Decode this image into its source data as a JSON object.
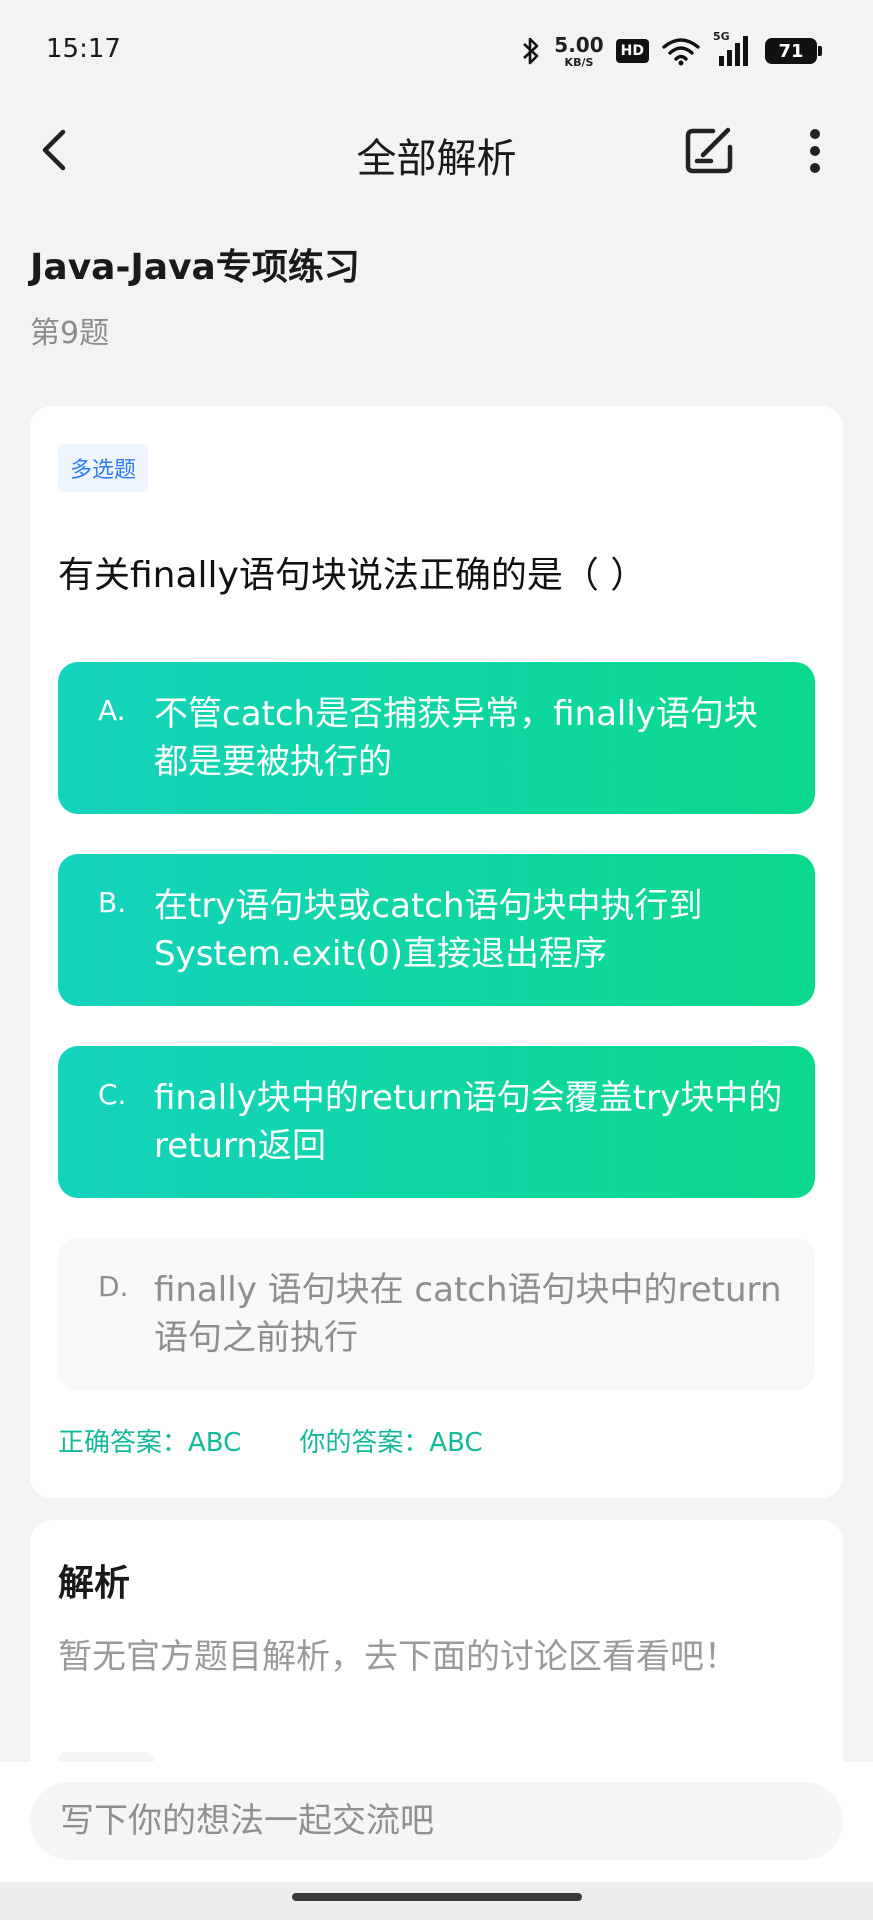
{
  "status_bar": {
    "time": "15:17",
    "net_speed_value": "5.00",
    "net_speed_unit": "KB/S",
    "hd_label": "HD",
    "signal_label": "5G",
    "battery_level": "71"
  },
  "header": {
    "title": "全部解析"
  },
  "subject": {
    "title": "Java-Java专项练习",
    "question_index": "第9题"
  },
  "question": {
    "type_tag": "多选题",
    "text": "有关finally语句块说法正确的是（ ）",
    "options": [
      {
        "letter": "A.",
        "text": "不管catch是否捕获异常，finally语句块都是要被执行的",
        "state": "correct"
      },
      {
        "letter": "B.",
        "text": "在try语句块或catch语句块中执行到System.exit(0)直接退出程序",
        "state": "correct"
      },
      {
        "letter": "C.",
        "text": "finally块中的return语句会覆盖try块中的return返回",
        "state": "correct"
      },
      {
        "letter": "D.",
        "text": "finally 语句块在 catch语句块中的return语句之前执行",
        "state": "plain"
      }
    ],
    "correct_answer": "正确答案：ABC",
    "your_answer": "你的答案：ABC"
  },
  "analysis": {
    "title": "解析",
    "text": "暂无官方题目解析，去下面的讨论区看看吧！"
  },
  "comment": {
    "placeholder": "写下你的想法一起交流吧"
  },
  "colors": {
    "correct_gradient_start": "#14d3bd",
    "correct_gradient_end": "#0bd98c",
    "answer_text": "#14b89a",
    "tag_text": "#2f7cf6",
    "tag_bg": "#eef5ff"
  },
  "icons": {
    "back": "chevron-left-icon",
    "edit": "edit-note-icon",
    "more": "more-vertical-icon",
    "bluetooth": "bluetooth-icon",
    "wifi": "wifi-icon",
    "signal": "cell-signal-icon",
    "battery": "battery-icon"
  }
}
